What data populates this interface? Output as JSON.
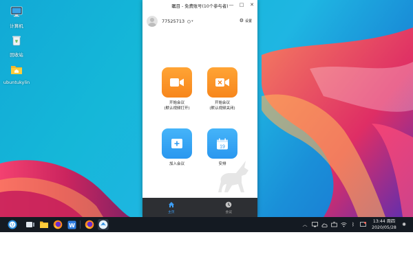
{
  "desktop": {
    "icons": [
      {
        "label": "计算机"
      },
      {
        "label": "回收站"
      },
      {
        "label": "ubuntukylin"
      }
    ]
  },
  "window": {
    "title": "瞩目 - 免费账号(10个参与者)",
    "user": {
      "id": "77525713",
      "status_arrow": "▾"
    },
    "settings_label": "设置",
    "tiles": [
      {
        "line1": "开始会议",
        "line2": "(默认视频打开)"
      },
      {
        "line1": "开始会议",
        "line2": "(默认视频关闭)"
      },
      {
        "line1": "加入会议",
        "line2": ""
      },
      {
        "line1": "安排",
        "line2": ""
      }
    ],
    "calendar_day": "19",
    "nav": [
      {
        "label": "主页"
      },
      {
        "label": "会议"
      }
    ]
  },
  "taskbar": {
    "clock": {
      "time": "13:44 周四",
      "date": "2020/05/28"
    }
  },
  "colors": {
    "tile_orange": "#f7861c",
    "tile_blue": "#2a97ef",
    "nav_active": "#3d9df3",
    "taskbar": "#141a22"
  }
}
